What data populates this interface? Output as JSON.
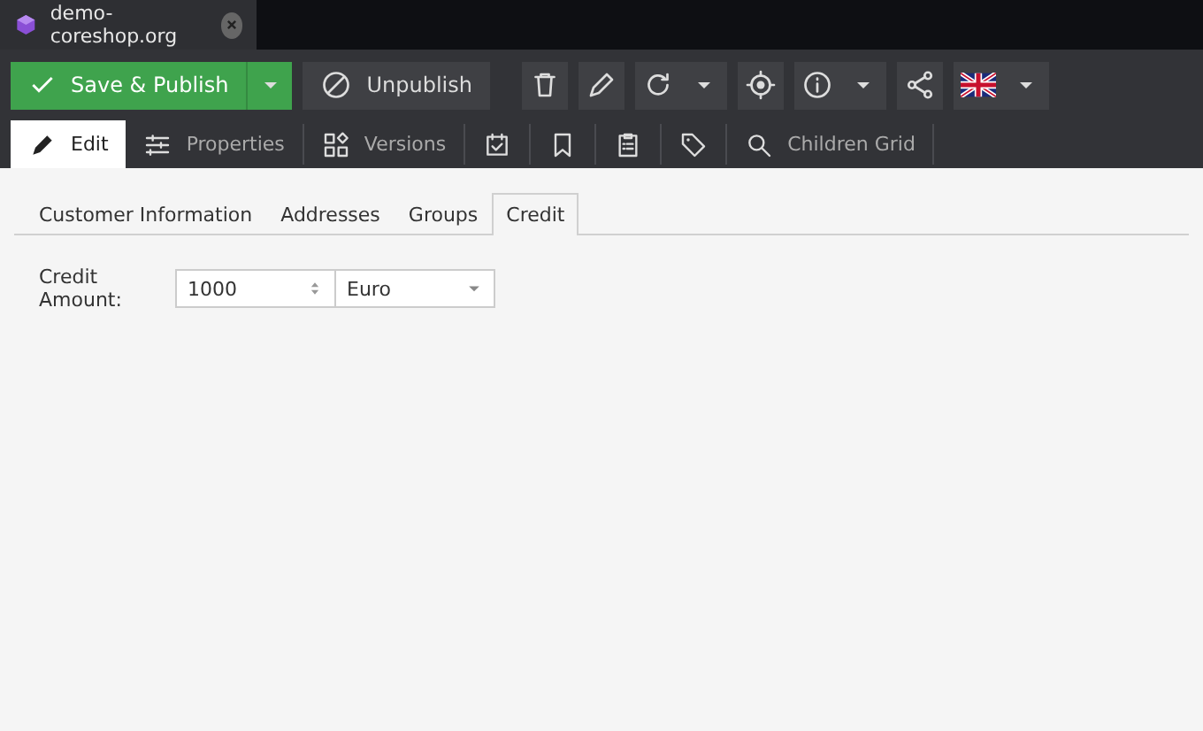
{
  "window_tab": {
    "title": "demo-coreshop.org"
  },
  "toolbar": {
    "primary": "Save & Publish",
    "secondary": "Unpublish"
  },
  "object_tabs": [
    {
      "label": "Edit",
      "selected": true
    },
    {
      "label": "Properties",
      "selected": false
    },
    {
      "label": "Versions",
      "selected": false
    },
    {
      "selected": false
    },
    {
      "selected": false
    },
    {
      "selected": false
    },
    {
      "selected": false
    },
    {
      "label": "Children Grid",
      "selected": false
    }
  ],
  "sub_tabs": [
    {
      "label": "Customer Information",
      "selected": false
    },
    {
      "label": "Addresses",
      "selected": false
    },
    {
      "label": "Groups",
      "selected": false
    },
    {
      "label": "Credit",
      "selected": true
    }
  ],
  "form": {
    "label": "Credit Amount:",
    "amount": "1000",
    "currency": "Euro"
  }
}
